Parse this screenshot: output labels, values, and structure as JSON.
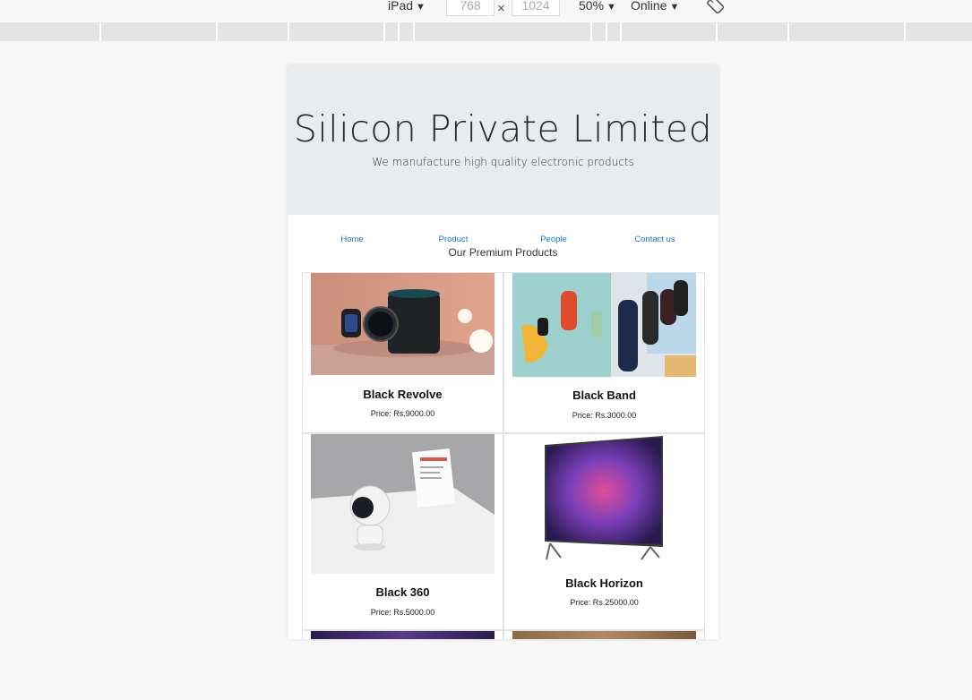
{
  "devtools": {
    "device": "iPad",
    "width": "768",
    "separator": "×",
    "height": "1024",
    "zoom": "50%",
    "network": "Online",
    "caret": "▼"
  },
  "site": {
    "title": "Silicon Private Limited",
    "tagline": "We manufacture high quality electronic products",
    "nav": [
      "Home",
      "Product",
      "People",
      "Contact us"
    ],
    "section_title": "Our Premium Products"
  },
  "products": [
    {
      "name": "Black Revolve",
      "price": "Price: Rs.9000.00"
    },
    {
      "name": "Black Band",
      "price": "Price: Rs.3000.00"
    },
    {
      "name": "Black 360",
      "price": "Price: Rs.5000.00"
    },
    {
      "name": "Black Horizon",
      "price": "Price: Rs.25000.00"
    }
  ],
  "colors": {
    "link": "#1a73d9",
    "jumbotron": "#e9ecef"
  }
}
